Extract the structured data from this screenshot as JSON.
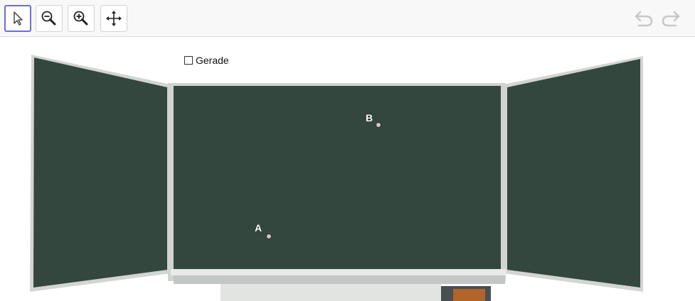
{
  "toolbar": {
    "tools": [
      {
        "name": "move-tool",
        "icon": "cursor-arrow-icon",
        "active": true
      },
      {
        "name": "zoom-out-tool",
        "icon": "zoom-out-icon",
        "active": false
      },
      {
        "name": "zoom-in-tool",
        "icon": "zoom-in-icon",
        "active": false
      },
      {
        "name": "move-view-tool",
        "icon": "move-arrows-icon",
        "active": false
      }
    ],
    "undo_icon": "undo-icon",
    "redo_icon": "redo-icon",
    "icon_color_disabled": "#c8c8c8",
    "active_border_color": "#6b6fd4"
  },
  "checkbox": {
    "label": "Gerade",
    "checked": false
  },
  "points": [
    {
      "label": "A"
    },
    {
      "label": "B"
    }
  ],
  "colors": {
    "board_green": "#33473f",
    "board_frame": "#c9ccc9",
    "point_fill": "#c8c8c8"
  }
}
